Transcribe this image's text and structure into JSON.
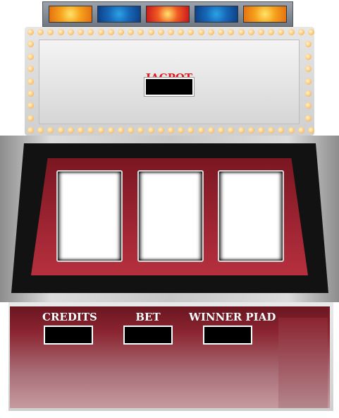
{
  "game": {
    "top_lights": [
      {
        "name": "orange-lamp",
        "color": "#f6a21b"
      },
      {
        "name": "blue-lamp",
        "color": "#1768b8"
      },
      {
        "name": "red-lamp",
        "color": "#f05a22"
      },
      {
        "name": "blue-lamp",
        "color": "#1768b8"
      },
      {
        "name": "orange-lamp",
        "color": "#f6a21b"
      }
    ],
    "jackpot": {
      "label": "JACPOT",
      "value": ""
    },
    "reels": [
      {
        "symbol": ""
      },
      {
        "symbol": ""
      },
      {
        "symbol": ""
      }
    ],
    "credits": {
      "label": "CREDITS",
      "value": ""
    },
    "bet": {
      "label": "BET",
      "value": ""
    },
    "winner_paid": {
      "label": "WINNER PIAD",
      "value": ""
    }
  },
  "colors": {
    "accent_red": "#e5161d",
    "panel_maroon": "#8a2430",
    "display_black": "#000000",
    "bulb_orange": "#ffc878"
  }
}
